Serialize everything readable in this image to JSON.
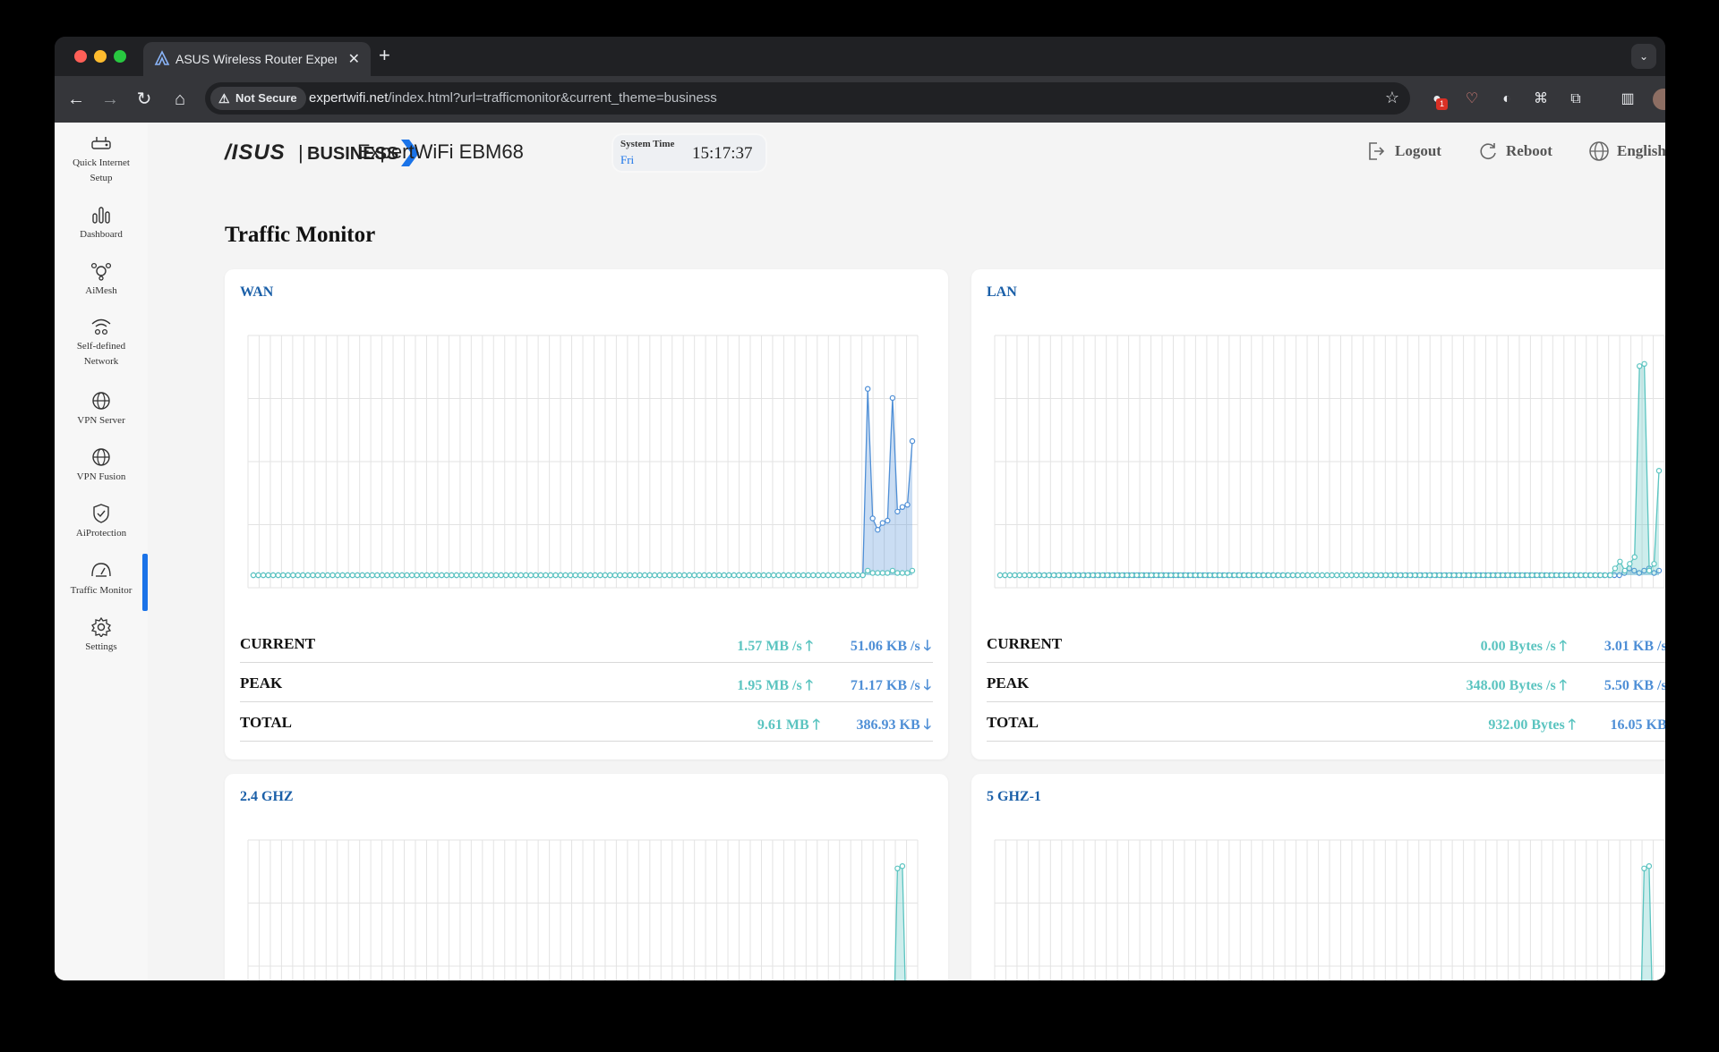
{
  "browser": {
    "tab_title": "ASUS Wireless Router Exper",
    "tab_close": "✕",
    "new_tab": "+",
    "security_label": "Not Secure",
    "url_host": "expertwifi.net",
    "url_path": "/index.html?url=trafficmonitor&current_theme=business",
    "extension_badge": "1"
  },
  "sidebar": {
    "items": [
      {
        "label": "Quick Internet Setup",
        "icon": "router-setup-icon"
      },
      {
        "label": "Dashboard",
        "icon": "bar-chart-icon"
      },
      {
        "label": "AiMesh",
        "icon": "mesh-icon"
      },
      {
        "label": "Self-defined Network",
        "icon": "network-icon"
      },
      {
        "label": "VPN Server",
        "icon": "globe-icon"
      },
      {
        "label": "VPN Fusion",
        "icon": "globe-icon"
      },
      {
        "label": "AiProtection",
        "icon": "shield-icon"
      },
      {
        "label": "Traffic Monitor",
        "icon": "gauge-icon",
        "active": true
      },
      {
        "label": "Settings",
        "icon": "gear-icon"
      }
    ]
  },
  "header": {
    "brand_asus": "/ISUS",
    "brand_separator": "|",
    "brand_business": "BUSINESS",
    "model": "ExpertWiFi EBM68",
    "system_time_label": "System Time",
    "system_day": "Fri",
    "system_time": "15:17:37",
    "logout": "Logout",
    "reboot": "Reboot",
    "language": "English"
  },
  "page": {
    "title": "Traffic Monitor"
  },
  "labels": {
    "current": "CURRENT",
    "peak": "PEAK",
    "total": "TOTAL"
  },
  "colors": {
    "upload": "#5bc4c0",
    "download": "#4f8fd6",
    "accent": "#1a73e8"
  },
  "monitors": [
    {
      "name": "WAN",
      "current": {
        "up": "1.57 MB /s",
        "down": "51.06 KB /s"
      },
      "peak": {
        "up": "1.95 MB /s",
        "down": "71.17 KB /s"
      },
      "total": {
        "up": "9.61 MB",
        "down": "386.93 KB"
      }
    },
    {
      "name": "LAN",
      "current": {
        "up": "0.00 Bytes /s",
        "down": "3.01 KB /s"
      },
      "peak": {
        "up": "348.00 Bytes /s",
        "down": "5.50 KB /s"
      },
      "total": {
        "up": "932.00 Bytes",
        "down": "16.05 KB"
      }
    },
    {
      "name": "2.4 GHZ"
    },
    {
      "name": "5 GHZ-1"
    }
  ],
  "chart_data": [
    {
      "type": "area",
      "name": "WAN",
      "series": [
        {
          "color": "#4f8fd6",
          "values": [
            0,
            0,
            0,
            0,
            0,
            0,
            0,
            0,
            0,
            0,
            0,
            0,
            0,
            0,
            0,
            0,
            0,
            0,
            0,
            0,
            0,
            0,
            0,
            0,
            0,
            0,
            0,
            0,
            0,
            0,
            0,
            0,
            0,
            0,
            0,
            0,
            0,
            0,
            0,
            0,
            0,
            0,
            0,
            0,
            0,
            0,
            0,
            0,
            0,
            0,
            0,
            0,
            0,
            0,
            0,
            0,
            0,
            0,
            0,
            0,
            0,
            0,
            0,
            0,
            0,
            0,
            0,
            0,
            0,
            0,
            0,
            0,
            0,
            0,
            0,
            0,
            0,
            0,
            0,
            0,
            0,
            0,
            0,
            0,
            0,
            0,
            0,
            0,
            0,
            0,
            0,
            0,
            0,
            0,
            0,
            0,
            0,
            0,
            0,
            0,
            0,
            0,
            0,
            0,
            0,
            0,
            0,
            0,
            0,
            0,
            0,
            0,
            0,
            0,
            0,
            0,
            0,
            0,
            0,
            0,
            0,
            0,
            0,
            0,
            0.82,
            0.25,
            0.2,
            0.23,
            0.24,
            0.78,
            0.28,
            0.3,
            0.31,
            0.59
          ]
        },
        {
          "color": "#5bc4c0",
          "values": [
            0,
            0,
            0,
            0,
            0,
            0,
            0,
            0,
            0,
            0,
            0,
            0,
            0,
            0,
            0,
            0,
            0,
            0,
            0,
            0,
            0,
            0,
            0,
            0,
            0,
            0,
            0,
            0,
            0,
            0,
            0,
            0,
            0,
            0,
            0,
            0,
            0,
            0,
            0,
            0,
            0,
            0,
            0,
            0,
            0,
            0,
            0,
            0,
            0,
            0,
            0,
            0,
            0,
            0,
            0,
            0,
            0,
            0,
            0,
            0,
            0,
            0,
            0,
            0,
            0,
            0,
            0,
            0,
            0,
            0,
            0,
            0,
            0,
            0,
            0,
            0,
            0,
            0,
            0,
            0,
            0,
            0,
            0,
            0,
            0,
            0,
            0,
            0,
            0,
            0,
            0,
            0,
            0,
            0,
            0,
            0,
            0,
            0,
            0,
            0,
            0,
            0,
            0,
            0,
            0,
            0,
            0,
            0,
            0,
            0,
            0,
            0,
            0,
            0,
            0,
            0,
            0,
            0,
            0,
            0,
            0,
            0,
            0,
            0,
            0.02,
            0.01,
            0.01,
            0.01,
            0.01,
            0.02,
            0.01,
            0.01,
            0.01,
            0.02
          ]
        }
      ]
    },
    {
      "type": "area",
      "name": "LAN",
      "series": [
        {
          "color": "#4f8fd6",
          "values": [
            0,
            0,
            0,
            0,
            0,
            0,
            0,
            0,
            0,
            0,
            0,
            0,
            0,
            0,
            0,
            0,
            0,
            0,
            0,
            0,
            0,
            0,
            0,
            0,
            0,
            0,
            0,
            0,
            0,
            0,
            0,
            0,
            0,
            0,
            0,
            0,
            0,
            0,
            0,
            0,
            0,
            0,
            0,
            0,
            0,
            0,
            0,
            0,
            0,
            0,
            0,
            0,
            0,
            0,
            0,
            0,
            0,
            0,
            0,
            0,
            0,
            0,
            0,
            0,
            0,
            0,
            0,
            0,
            0,
            0,
            0,
            0,
            0,
            0,
            0,
            0,
            0,
            0,
            0,
            0,
            0,
            0,
            0,
            0,
            0,
            0,
            0,
            0,
            0,
            0,
            0,
            0,
            0,
            0,
            0,
            0,
            0,
            0,
            0,
            0,
            0,
            0,
            0,
            0,
            0,
            0,
            0,
            0,
            0,
            0,
            0,
            0,
            0,
            0,
            0,
            0,
            0,
            0,
            0,
            0,
            0,
            0,
            0,
            0,
            0,
            0,
            0.01,
            0.03,
            0.02,
            0.01,
            0.02,
            0.03,
            0.01,
            0.02
          ]
        },
        {
          "color": "#5bc4c0",
          "values": [
            0,
            0,
            0,
            0,
            0,
            0,
            0,
            0,
            0,
            0,
            0,
            0,
            0,
            0,
            0,
            0,
            0,
            0,
            0,
            0,
            0,
            0,
            0,
            0,
            0,
            0,
            0,
            0,
            0,
            0,
            0,
            0,
            0,
            0,
            0,
            0,
            0,
            0,
            0,
            0,
            0,
            0,
            0,
            0,
            0,
            0,
            0,
            0,
            0,
            0,
            0,
            0,
            0,
            0,
            0,
            0,
            0,
            0,
            0,
            0,
            0,
            0,
            0,
            0,
            0,
            0,
            0,
            0,
            0,
            0,
            0,
            0,
            0,
            0,
            0,
            0,
            0,
            0,
            0,
            0,
            0,
            0,
            0,
            0,
            0,
            0,
            0,
            0,
            0,
            0,
            0,
            0,
            0,
            0,
            0,
            0,
            0,
            0,
            0,
            0,
            0,
            0,
            0,
            0,
            0,
            0,
            0,
            0,
            0,
            0,
            0,
            0,
            0,
            0,
            0,
            0,
            0,
            0,
            0,
            0,
            0,
            0,
            0,
            0,
            0,
            0,
            0.03,
            0.06,
            0.02,
            0.05,
            0.08,
            0.92,
            0.93,
            0.02,
            0.05,
            0.46
          ]
        }
      ]
    },
    {
      "type": "area",
      "name": "2.4 GHZ",
      "series": [
        {
          "color": "#5bc4c0",
          "values": [
            0,
            0,
            0,
            0,
            0,
            0,
            0,
            0,
            0,
            0,
            0,
            0,
            0,
            0,
            0,
            0,
            0,
            0,
            0,
            0,
            0,
            0,
            0,
            0,
            0,
            0,
            0,
            0,
            0,
            0,
            0,
            0,
            0,
            0,
            0,
            0,
            0,
            0,
            0,
            0,
            0,
            0,
            0,
            0,
            0,
            0,
            0,
            0,
            0,
            0,
            0,
            0,
            0,
            0,
            0,
            0,
            0,
            0,
            0,
            0,
            0,
            0,
            0,
            0,
            0,
            0,
            0,
            0,
            0,
            0,
            0,
            0,
            0,
            0,
            0,
            0,
            0,
            0,
            0,
            0,
            0,
            0,
            0,
            0,
            0,
            0,
            0,
            0,
            0,
            0,
            0,
            0,
            0,
            0,
            0,
            0,
            0,
            0,
            0,
            0,
            0,
            0,
            0,
            0,
            0,
            0,
            0,
            0,
            0,
            0,
            0,
            0,
            0,
            0,
            0,
            0,
            0,
            0,
            0,
            0,
            0,
            0,
            0,
            0,
            0,
            0,
            0,
            0,
            0,
            0,
            0.93,
            0.94,
            0.02,
            0.05
          ]
        }
      ]
    },
    {
      "type": "area",
      "name": "5 GHZ-1",
      "series": [
        {
          "color": "#5bc4c0",
          "values": [
            0,
            0,
            0,
            0,
            0,
            0,
            0,
            0,
            0,
            0,
            0,
            0,
            0,
            0,
            0,
            0,
            0,
            0,
            0,
            0,
            0,
            0,
            0,
            0,
            0,
            0,
            0,
            0,
            0,
            0,
            0,
            0,
            0,
            0,
            0,
            0,
            0,
            0,
            0,
            0,
            0,
            0,
            0,
            0,
            0,
            0,
            0,
            0,
            0,
            0,
            0,
            0,
            0,
            0,
            0,
            0,
            0,
            0,
            0,
            0,
            0,
            0,
            0,
            0,
            0,
            0,
            0,
            0,
            0,
            0,
            0,
            0,
            0,
            0,
            0,
            0,
            0,
            0,
            0,
            0,
            0,
            0,
            0,
            0,
            0,
            0,
            0,
            0,
            0,
            0,
            0,
            0,
            0,
            0,
            0,
            0,
            0,
            0,
            0,
            0,
            0,
            0,
            0,
            0,
            0,
            0,
            0,
            0,
            0,
            0,
            0,
            0,
            0,
            0,
            0,
            0,
            0,
            0,
            0,
            0,
            0,
            0,
            0,
            0,
            0,
            0,
            0,
            0,
            0,
            0,
            0.93,
            0.94,
            0.02,
            0.05
          ]
        }
      ]
    }
  ]
}
